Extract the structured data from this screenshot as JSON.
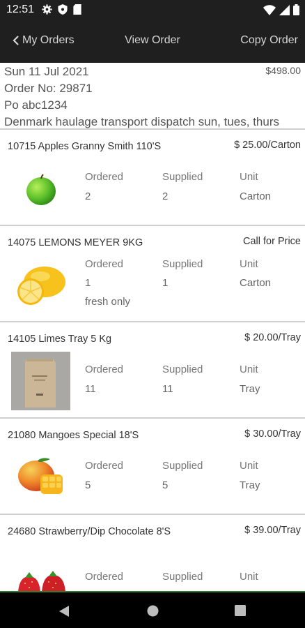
{
  "status_bar": {
    "time": "12:51"
  },
  "nav": {
    "back_label": "My Orders",
    "title": "View Order",
    "action_label": "Copy Order"
  },
  "order": {
    "date": "Sun 11 Jul 2021",
    "total": "$498.00",
    "order_no": "Order No: 29871",
    "po": "Po abc1234",
    "note": "Denmark haulage transport dispatch sun, tues, thurs"
  },
  "columns": {
    "ordered": "Ordered",
    "supplied": "Supplied",
    "unit": "Unit"
  },
  "items": [
    {
      "name": "10715 Apples Granny Smith 110'S",
      "price": "$ 25.00/Carton",
      "ordered": "2",
      "supplied": "2",
      "unit": "Carton",
      "note": "",
      "image": "green-apple"
    },
    {
      "name": "14075 LEMONS MEYER 9KG",
      "price": "Call for Price",
      "ordered": "1",
      "supplied": "1",
      "unit": "Carton",
      "note": "fresh only",
      "image": "lemon"
    },
    {
      "name": "14105 Limes Tray 5 Kg",
      "price": "$ 20.00/Tray",
      "ordered": "11",
      "supplied": "11",
      "unit": "Tray",
      "note": "",
      "image": "kraft-bag"
    },
    {
      "name": "21080 Mangoes Special 18'S",
      "price": "$ 30.00/Tray",
      "ordered": "5",
      "supplied": "5",
      "unit": "Tray",
      "note": "",
      "image": "mango"
    },
    {
      "name": "24680 Strawberry/Dip Chocolate 8'S",
      "price": "$ 39.00/Tray",
      "ordered": "",
      "supplied": "",
      "unit": "",
      "note": "",
      "image": "strawberries"
    }
  ]
}
